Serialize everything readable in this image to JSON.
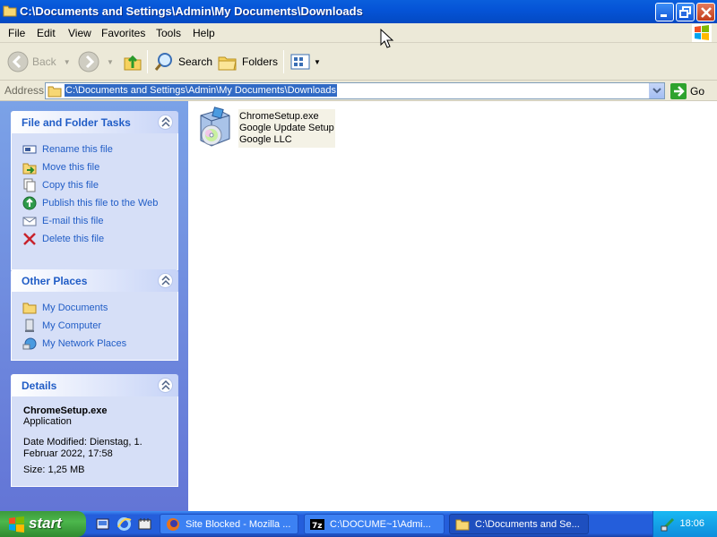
{
  "window": {
    "title": "C:\\Documents and Settings\\Admin\\My Documents\\Downloads"
  },
  "menu": [
    "File",
    "Edit",
    "View",
    "Favorites",
    "Tools",
    "Help"
  ],
  "toolbar": {
    "back": "Back",
    "search": "Search",
    "folders": "Folders"
  },
  "address": {
    "label": "Address",
    "value": "C:\\Documents and Settings\\Admin\\My Documents\\Downloads",
    "go": "Go"
  },
  "tasks_panel": {
    "title": "File and Folder Tasks",
    "items": [
      {
        "label": "Rename this file",
        "icon": "rename-icon"
      },
      {
        "label": "Move this file",
        "icon": "move-icon"
      },
      {
        "label": "Copy this file",
        "icon": "copy-icon"
      },
      {
        "label": "Publish this file to the Web",
        "icon": "publish-icon"
      },
      {
        "label": "E-mail this file",
        "icon": "email-icon"
      },
      {
        "label": "Delete this file",
        "icon": "delete-icon"
      }
    ]
  },
  "other_places": {
    "title": "Other Places",
    "items": [
      {
        "label": "My Documents",
        "icon": "folder-icon"
      },
      {
        "label": "My Computer",
        "icon": "computer-icon"
      },
      {
        "label": "My Network Places",
        "icon": "network-icon"
      }
    ]
  },
  "details": {
    "title": "Details",
    "name": "ChromeSetup.exe",
    "type": "Application",
    "modified": "Date Modified: Dienstag, 1. Februar 2022, 17:58",
    "size": "Size: 1,25 MB"
  },
  "file": {
    "name": "ChromeSetup.exe",
    "description": "Google Update Setup",
    "company": "Google LLC"
  },
  "taskbar": {
    "start": "start",
    "buttons": [
      {
        "label": "Site Blocked - Mozilla ...",
        "icon": "firefox-icon"
      },
      {
        "label": "C:\\DOCUME~1\\Admi...",
        "icon": "7zip-icon"
      },
      {
        "label": "C:\\Documents and Se...",
        "icon": "folder-icon"
      }
    ],
    "clock": "18:06"
  },
  "colors": {
    "titlebar": "#0553d6",
    "taskpane": "#6375d6",
    "link": "#215dc6",
    "selection": "#316ac5",
    "start": "#3c9a3c"
  }
}
